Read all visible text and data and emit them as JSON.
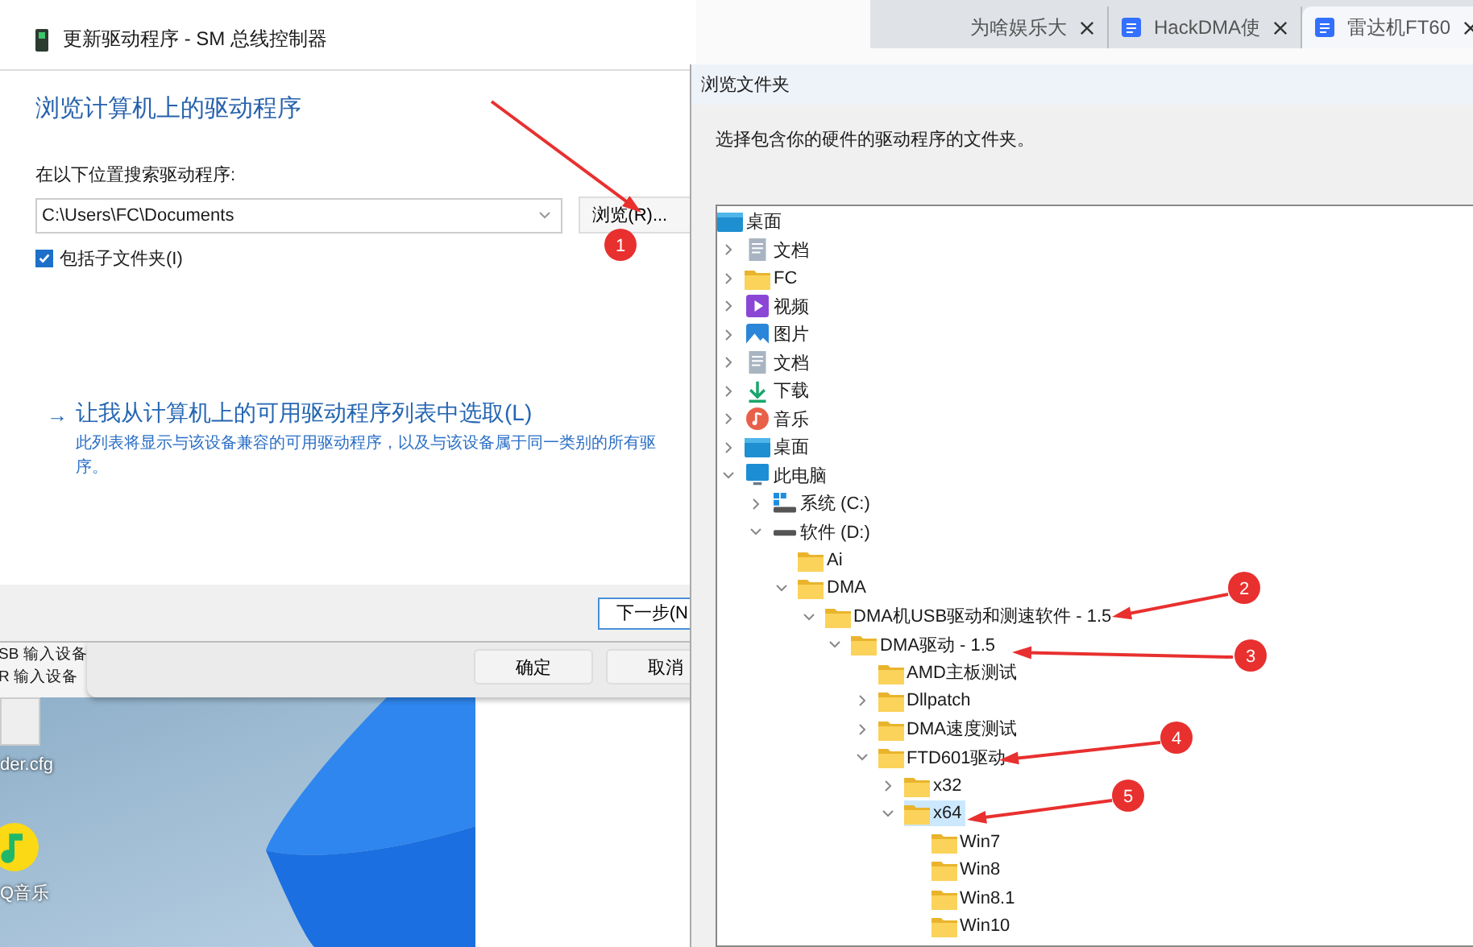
{
  "browser_tabs": [
    {
      "label": "为啥娱乐大",
      "icon_shown": false,
      "selected": false
    },
    {
      "label": "HackDMA使",
      "icon_shown": true,
      "selected": false
    },
    {
      "label": "雷达机FT60",
      "icon_shown": true,
      "selected": true
    }
  ],
  "wizard": {
    "title": "更新驱动程序 - SM 总线控制器",
    "heading": "浏览计算机上的驱动程序",
    "search_label": "在以下位置搜索驱动程序:",
    "path_value": "C:\\Users\\FC\\Documents",
    "browse_button": "浏览(R)...",
    "include_subfolders": {
      "label": "包括子文件夹(I)",
      "checked": true
    },
    "pick_link": {
      "arrow": "→",
      "label": "让我从计算机上的可用驱动程序列表中选取(L)"
    },
    "description_lines": [
      "此列表将显示与该设备兼容的可用驱动程序，以及与该设备属于同一类别的所有驱",
      "序。"
    ],
    "next_button": "下一步(N"
  },
  "device_manager": {
    "devices": [
      "SB 输入设备",
      "R 输入设备"
    ],
    "buttons": [
      "确定",
      "取消"
    ]
  },
  "desktop": {
    "icons": [
      {
        "label": "der.cfg",
        "kind": "file"
      },
      {
        "label": "Q音乐",
        "kind": "music-app"
      }
    ]
  },
  "browse_dialog": {
    "title": "浏览文件夹",
    "instruction": "选择包含你的硬件的驱动程序的文件夹。",
    "tree": [
      {
        "label": "桌面",
        "kind": "desktop",
        "selected": false,
        "children": [
          {
            "label": "文档",
            "kind": "document",
            "expandable": true,
            "expanded": false,
            "selected": false
          },
          {
            "label": "FC",
            "kind": "folder",
            "expandable": true,
            "expanded": false,
            "selected": false
          },
          {
            "label": "视频",
            "kind": "video",
            "expandable": true,
            "expanded": false,
            "selected": false
          },
          {
            "label": "图片",
            "kind": "picture",
            "expandable": true,
            "expanded": false,
            "selected": false
          },
          {
            "label": "文档",
            "kind": "document",
            "expandable": true,
            "expanded": false,
            "selected": false
          },
          {
            "label": "下载",
            "kind": "download",
            "expandable": true,
            "expanded": false,
            "selected": false
          },
          {
            "label": "音乐",
            "kind": "music",
            "expandable": true,
            "expanded": false,
            "selected": false
          },
          {
            "label": "桌面",
            "kind": "desktop",
            "expandable": true,
            "expanded": false,
            "selected": false
          },
          {
            "label": "此电脑",
            "kind": "computer",
            "expandable": true,
            "expanded": true,
            "selected": false,
            "children": [
              {
                "label": "系统 (C:)",
                "kind": "system-drive",
                "expandable": true,
                "expanded": false,
                "selected": false
              },
              {
                "label": "软件 (D:)",
                "kind": "drive",
                "expandable": true,
                "expanded": true,
                "selected": false,
                "children": [
                  {
                    "label": "Ai",
                    "kind": "folder",
                    "expandable": false,
                    "expanded": false,
                    "selected": false
                  },
                  {
                    "label": "DMA",
                    "kind": "folder",
                    "expandable": true,
                    "expanded": true,
                    "selected": false,
                    "children": [
                      {
                        "label": "DMA机USB驱动和测速软件 - 1.5",
                        "kind": "folder",
                        "expandable": true,
                        "expanded": true,
                        "selected": false,
                        "children": [
                          {
                            "label": "DMA驱动 - 1.5",
                            "kind": "folder",
                            "expandable": true,
                            "expanded": true,
                            "selected": false,
                            "children": [
                              {
                                "label": "AMD主板测试",
                                "kind": "folder",
                                "expandable": false,
                                "expanded": false,
                                "selected": false
                              },
                              {
                                "label": "Dllpatch",
                                "kind": "folder",
                                "expandable": true,
                                "expanded": false,
                                "selected": false
                              },
                              {
                                "label": "DMA速度测试",
                                "kind": "folder",
                                "expandable": true,
                                "expanded": false,
                                "selected": false
                              },
                              {
                                "label": "FTD601驱动",
                                "kind": "folder",
                                "expandable": true,
                                "expanded": true,
                                "selected": false,
                                "children": [
                                  {
                                    "label": "x32",
                                    "kind": "folder",
                                    "expandable": true,
                                    "expanded": false,
                                    "selected": false
                                  },
                                  {
                                    "label": "x64",
                                    "kind": "folder",
                                    "expandable": true,
                                    "expanded": true,
                                    "selected": true,
                                    "children": [
                                      {
                                        "label": "Win7",
                                        "kind": "folder",
                                        "expandable": false,
                                        "expanded": false,
                                        "selected": false
                                      },
                                      {
                                        "label": "Win8",
                                        "kind": "folder",
                                        "expandable": false,
                                        "expanded": false,
                                        "selected": false
                                      },
                                      {
                                        "label": "Win8.1",
                                        "kind": "folder",
                                        "expandable": false,
                                        "expanded": false,
                                        "selected": false
                                      },
                                      {
                                        "label": "Win10",
                                        "kind": "folder",
                                        "expandable": false,
                                        "expanded": false,
                                        "selected": false
                                      }
                                    ]
                                  }
                                ]
                              }
                            ]
                          }
                        ]
                      }
                    ]
                  }
                ]
              }
            ]
          }
        ]
      }
    ]
  },
  "annotations": [
    {
      "label": "1"
    },
    {
      "label": "2"
    },
    {
      "label": "3"
    },
    {
      "label": "4"
    },
    {
      "label": "5"
    }
  ]
}
